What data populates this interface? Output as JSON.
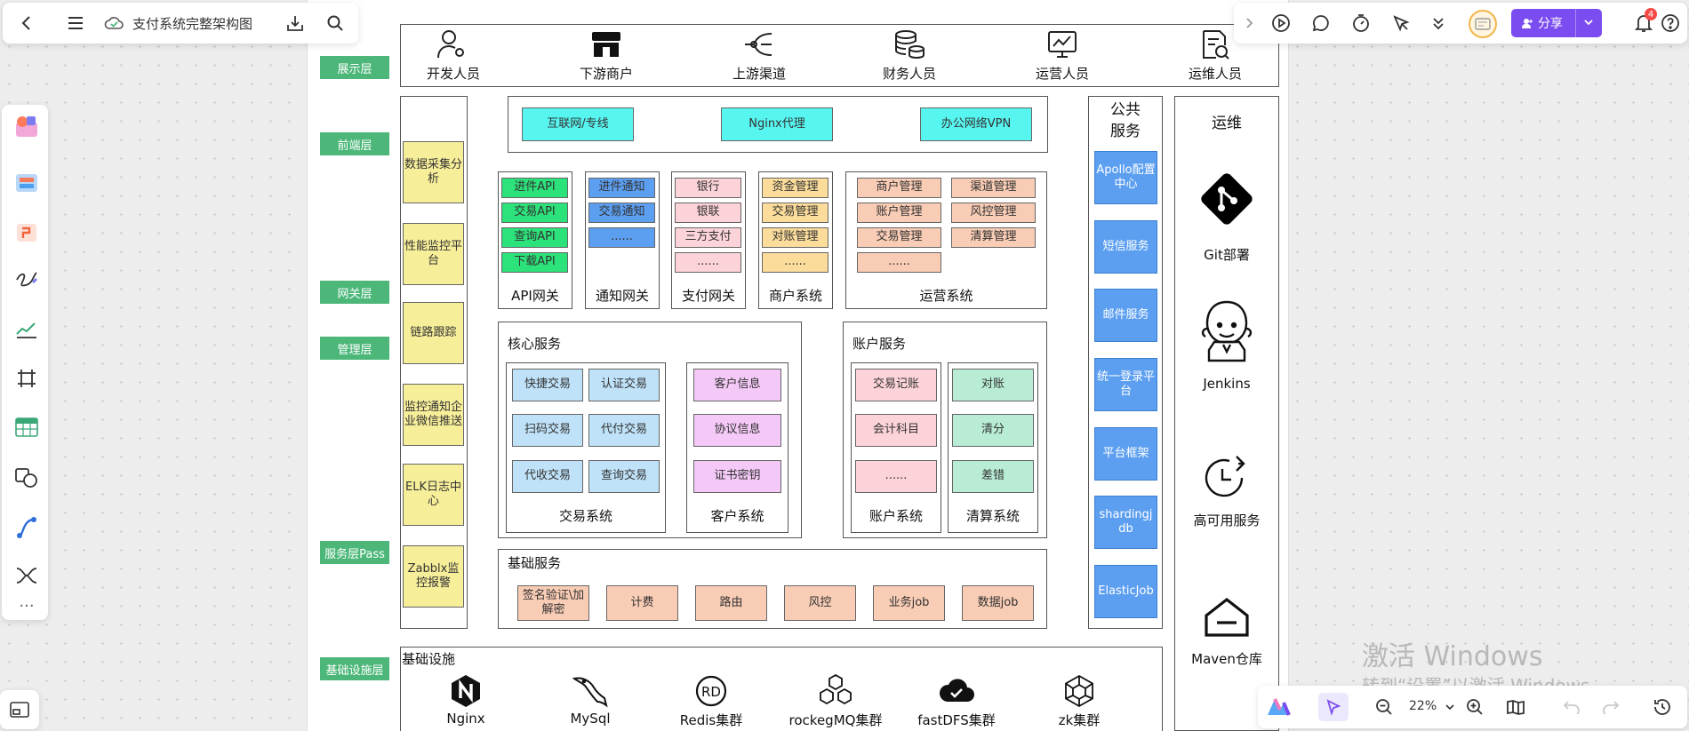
{
  "app": {
    "doc_title": "支付系统完整架构图",
    "share_label": "分享",
    "notif_count": "4",
    "zoom": "22%"
  },
  "watermark": {
    "line1": "激活 Windows",
    "line2": "转到“设置”以激活 Windows。"
  },
  "layers": [
    "展示层",
    "前端层",
    "网关层",
    "管理层",
    "服务层Pass",
    "基础设施层"
  ],
  "users": [
    "开发人员",
    "下游商户",
    "上游渠道",
    "财务人员",
    "运营人员",
    "运维人员"
  ],
  "frontend_tools": [
    "数据采集分析",
    "性能监控平台",
    "链路跟踪",
    "监控通知企业微信推送",
    "ELK日志中心",
    "Zabblx监控报警"
  ],
  "network": [
    "互联网/专线",
    "Nginx代理",
    "办公网络VPN"
  ],
  "api_gateway": {
    "title": "API网关",
    "items": [
      "进件API",
      "交易API",
      "查询API",
      "下载API"
    ]
  },
  "notify_gateway": {
    "title": "通知网关",
    "items": [
      "进件通知",
      "交易通知",
      "......"
    ]
  },
  "pay_gateway": {
    "title": "支付网关",
    "items": [
      "银行",
      "银联",
      "三方支付",
      "......"
    ]
  },
  "merchant_sys": {
    "title": "商户系统",
    "items": [
      "资金管理",
      "交易管理",
      "对账管理",
      "......"
    ]
  },
  "ops_sys": {
    "title": "运营系统",
    "items": [
      "商户管理",
      "渠道管理",
      "账户管理",
      "风控管理",
      "交易管理",
      "清算管理",
      "......"
    ]
  },
  "core": {
    "title": "核心服务",
    "trade": {
      "title": "交易系统",
      "items": [
        "快捷交易",
        "认证交易",
        "扫码交易",
        "代付交易",
        "代收交易",
        "查询交易"
      ]
    },
    "customer": {
      "title": "客户系统",
      "items": [
        "客户信息",
        "协议信息",
        "证书密钥"
      ]
    }
  },
  "account": {
    "title": "账户服务",
    "acct": {
      "title": "账户系统",
      "items": [
        "交易记账",
        "会计科目",
        "......"
      ]
    },
    "clear": {
      "title": "清算系统",
      "items": [
        "对账",
        "清分",
        "差错"
      ]
    }
  },
  "base": {
    "title": "基础服务",
    "items": [
      "签名验证\\加解密",
      "计费",
      "路由",
      "风控",
      "业务job",
      "数据job"
    ]
  },
  "public": {
    "title": "公共服务",
    "items": [
      "Apollo配置中心",
      "短信服务",
      "邮件服务",
      "统一登录平台",
      "平台框架",
      "shardingjdb",
      "ElasticJob"
    ]
  },
  "ops": {
    "title": "运维",
    "items": [
      "Git部署",
      "Jenkins",
      "高可用服务",
      "Maven仓库"
    ]
  },
  "infra": {
    "title": "基础设施",
    "items": [
      "Nginx",
      "MySql",
      "Redis集群",
      "rockegMQ集群",
      "fastDFS集群",
      "zk集群"
    ]
  },
  "colors": {
    "green": "#4cb779",
    "cyan": "#56f5f0",
    "yellow": "#f7ee9a",
    "blue": "#5c9ff0",
    "pink": "#fcd3d8",
    "tan": "#fbdc9a",
    "salmon": "#f9ccb5",
    "lightblue": "#bfe2f8",
    "violet": "#f5c9f7",
    "mint": "#b9ecd5",
    "apigreen": "#2ce27a",
    "share": "#7b4df0"
  }
}
